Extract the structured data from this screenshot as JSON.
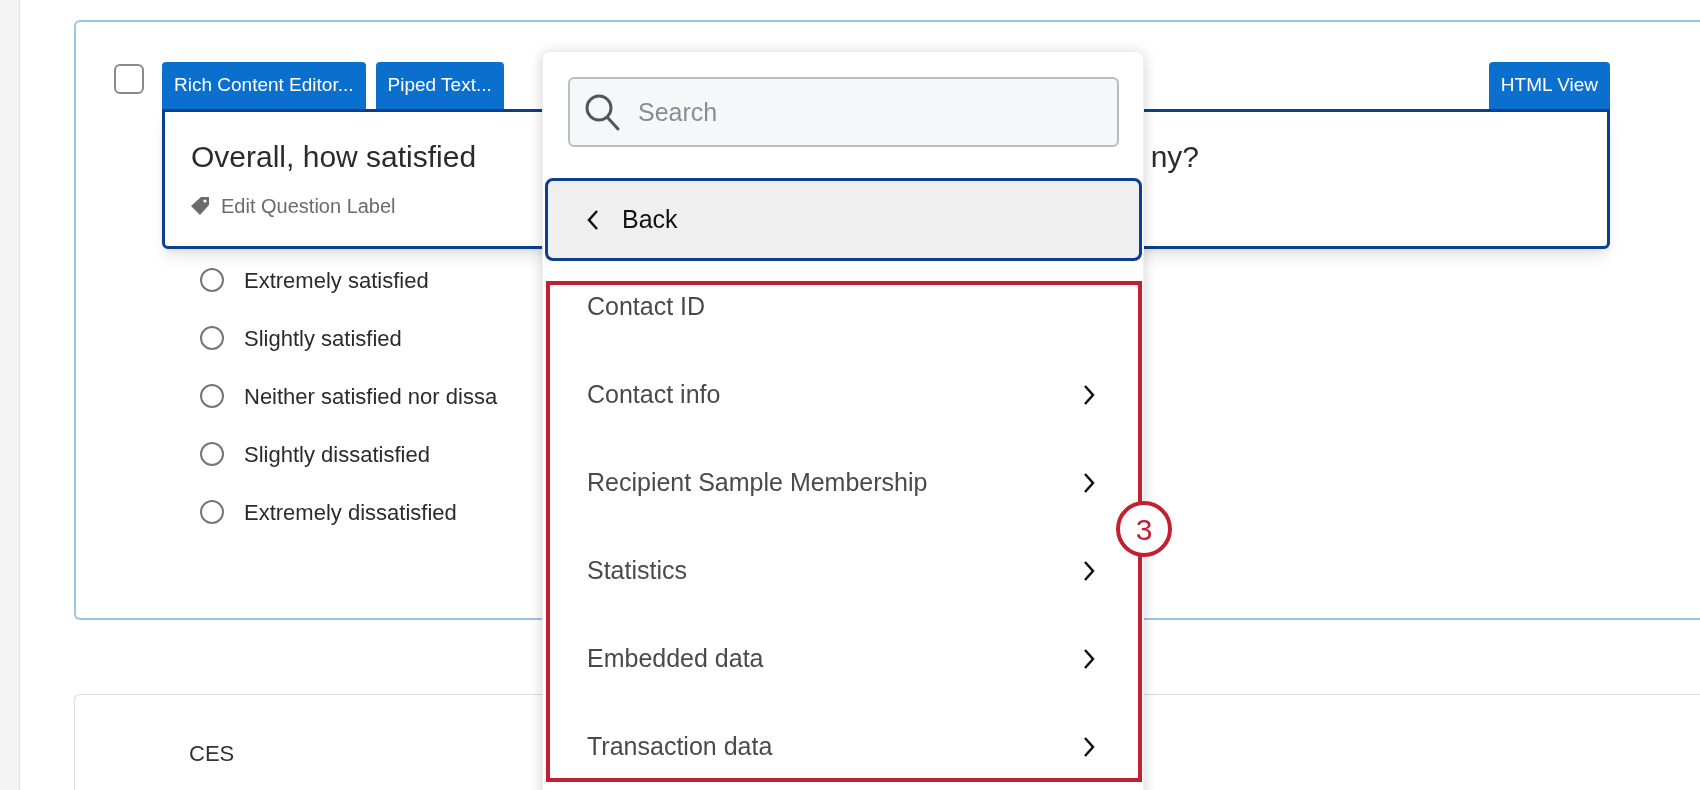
{
  "question_card": {
    "checkbox": {
      "checked": false
    },
    "editor_tabs": [
      {
        "label": "Rich Content Editor..."
      },
      {
        "label": "Piped Text..."
      }
    ],
    "html_view_tab": {
      "label": "HTML View"
    },
    "question_text": [
      "Overall, how satisfied",
      "ny?"
    ],
    "edit_label": "Edit Question Label",
    "options": [
      {
        "label": "Extremely satisfied",
        "selected": false
      },
      {
        "label": "Slightly satisfied",
        "selected": false
      },
      {
        "label": "Neither satisfied nor dissa",
        "selected": false
      },
      {
        "label": "Slightly dissatisfied",
        "selected": false
      },
      {
        "label": "Extremely dissatisfied",
        "selected": false
      }
    ]
  },
  "piped_text_menu": {
    "search": {
      "placeholder": "Search"
    },
    "back": {
      "label": "Back"
    },
    "items": [
      {
        "label": "Contact ID",
        "has_submenu": false
      },
      {
        "label": "Contact info",
        "has_submenu": true
      },
      {
        "label": "Recipient Sample Membership",
        "has_submenu": true
      },
      {
        "label": "Statistics",
        "has_submenu": true
      },
      {
        "label": "Embedded data",
        "has_submenu": true
      },
      {
        "label": "Transaction data",
        "has_submenu": true
      }
    ]
  },
  "callout": {
    "label": "3"
  },
  "next_question": {
    "title": "CES"
  }
}
